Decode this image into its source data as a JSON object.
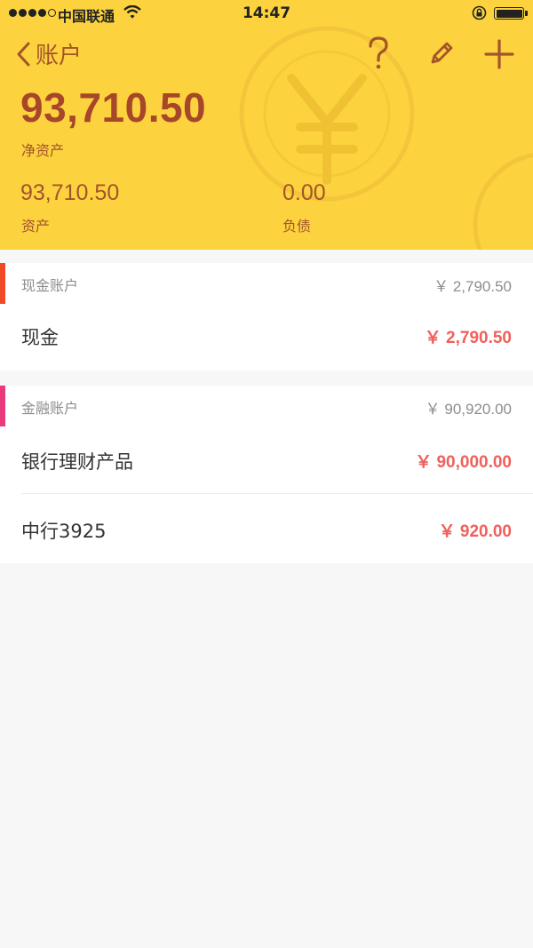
{
  "status_bar": {
    "carrier": "中国联通",
    "time": "14:47"
  },
  "nav": {
    "back_label": "账户",
    "icons": [
      "chevron-left-icon",
      "help-icon",
      "edit-pencil-icon",
      "add-plus-icon"
    ]
  },
  "summary": {
    "net_amount": "93,710.50",
    "net_label": "净资产",
    "assets_amount": "93,710.50",
    "assets_label": "资产",
    "liabilities_amount": "0.00",
    "liabilities_label": "负债"
  },
  "sections": [
    {
      "title": "现金账户",
      "total": "￥ 2,790.50",
      "accent": "#f04a27",
      "rows": [
        {
          "name": "现金",
          "amount": "￥ 2,790.50"
        }
      ]
    },
    {
      "title": "金融账户",
      "total": "￥ 90,920.00",
      "accent": "#e83a7d",
      "rows": [
        {
          "name": "银行理财产品",
          "amount": "￥ 90,000.00"
        },
        {
          "name": "中行3925",
          "amount": "￥ 920.00"
        }
      ]
    }
  ],
  "colors": {
    "header_bg": "#fcd33f",
    "header_text": "#a3542a",
    "amount_red": "#f0605c"
  }
}
